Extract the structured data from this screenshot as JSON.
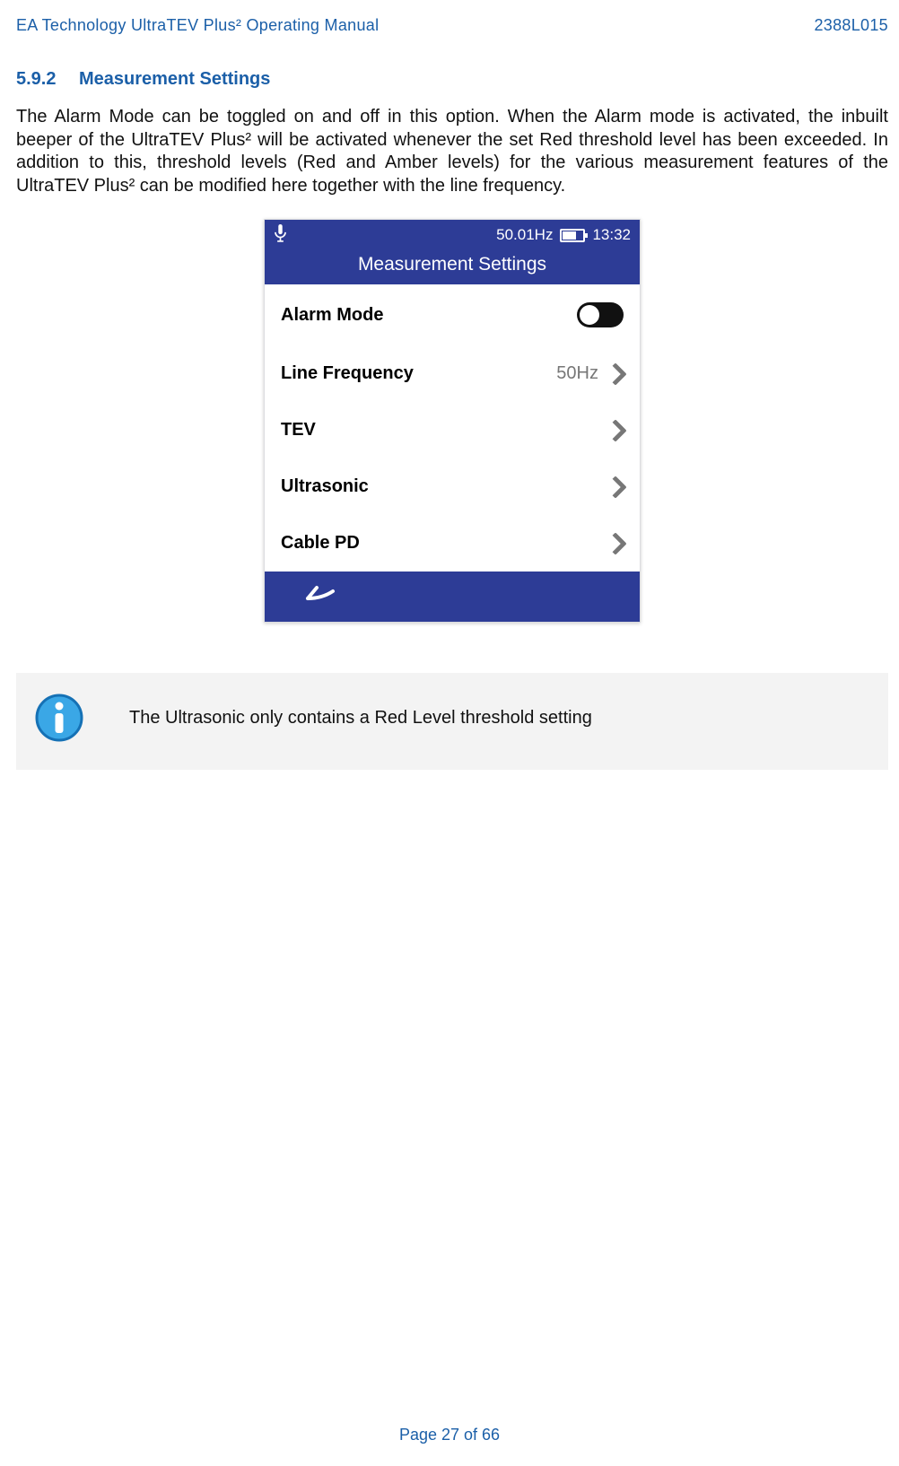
{
  "header": {
    "left": "EA Technology UltraTEV Plus² Operating Manual",
    "right": "2388L015"
  },
  "section": {
    "num": "5.9.2",
    "title": "Measurement Settings"
  },
  "body": "The Alarm Mode can be toggled on and off in this option. When the Alarm mode is activated, the inbuilt beeper of the UltraTEV Plus² will be activated whenever the set Red threshold level has been exceeded. In addition to this, threshold levels (Red and Amber levels) for the various measurement features of the UltraTEV Plus² can be modified here together with the line frequency.",
  "device": {
    "status": {
      "freq": "50.01Hz",
      "time": "13:32"
    },
    "title": "Measurement Settings",
    "rows": [
      {
        "label": "Alarm Mode",
        "value": "",
        "type": "toggle"
      },
      {
        "label": "Line Frequency",
        "value": "50Hz",
        "type": "nav"
      },
      {
        "label": "TEV",
        "value": "",
        "type": "nav"
      },
      {
        "label": "Ultrasonic",
        "value": "",
        "type": "nav"
      },
      {
        "label": "Cable PD",
        "value": "",
        "type": "nav"
      }
    ]
  },
  "info": "The Ultrasonic only contains a Red Level threshold setting",
  "footer": "Page 27 of 66"
}
